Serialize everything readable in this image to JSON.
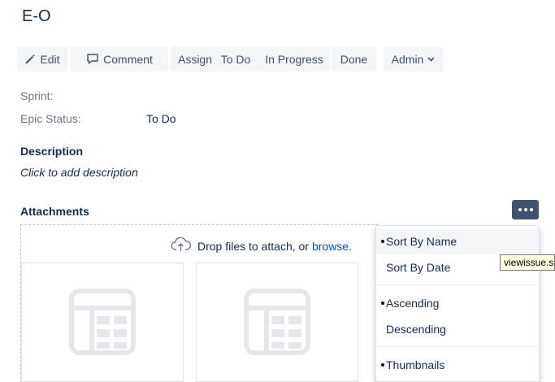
{
  "issue": {
    "title": "E-O"
  },
  "toolbar": {
    "edit_label": "Edit",
    "comment_label": "Comment",
    "assign_label": "Assign",
    "todo_label": "To Do",
    "in_progress_label": "In Progress",
    "done_label": "Done",
    "admin_label": "Admin"
  },
  "fields": {
    "sprint_label": "Sprint:",
    "sprint_value": "",
    "epic_status_label": "Epic Status:",
    "epic_status_value": "To Do"
  },
  "description": {
    "title": "Description",
    "placeholder": "Click to add description"
  },
  "attachments": {
    "title": "Attachments",
    "drop_text": "Drop files to attach, or",
    "browse_link": "browse."
  },
  "attachment_menu": {
    "items": [
      {
        "label": "Sort By Name",
        "selected": true
      },
      {
        "label": "Sort By Date",
        "selected": false
      },
      {
        "label": "Ascending",
        "selected": true
      },
      {
        "label": "Descending",
        "selected": false
      },
      {
        "label": "Thumbnails",
        "selected": true
      }
    ]
  },
  "tooltip": {
    "text": "viewissue.s"
  },
  "icons": {
    "edit": "pencil-icon",
    "comment": "speech-bubble-icon",
    "admin": "chevron-down-icon",
    "upload": "cloud-upload-icon",
    "more": "more-icon",
    "thumbnail": "spreadsheet-file-icon"
  },
  "colors": {
    "button_bg": "#f4f5f7",
    "more_button_bg": "#42526e",
    "link": "#0052cc",
    "text": "#172b4d",
    "muted": "#6b778c"
  }
}
